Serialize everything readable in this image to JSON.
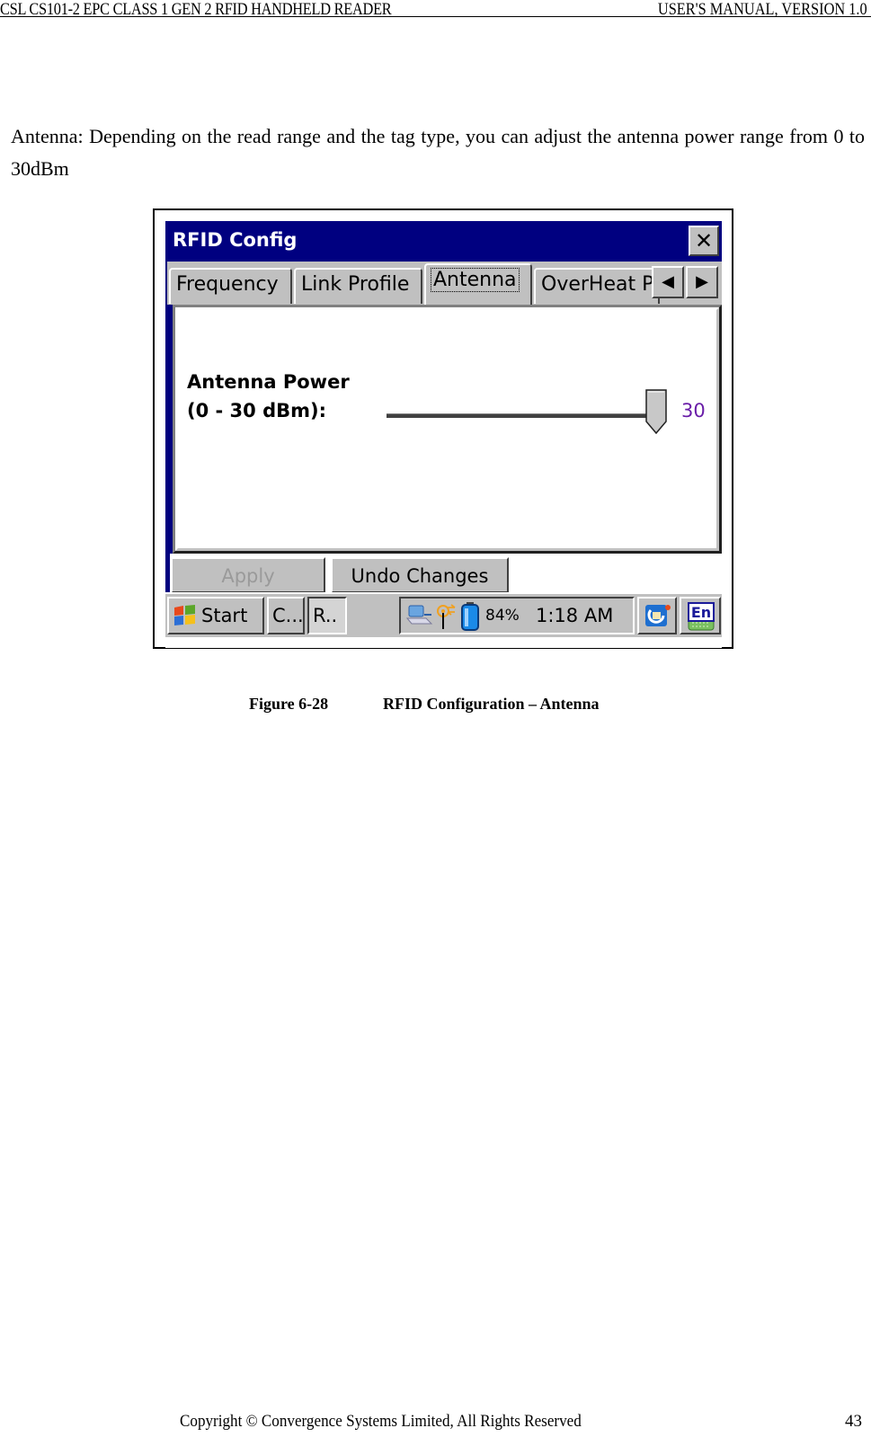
{
  "header": {
    "left": "CSL CS101-2 EPC CLASS 1 GEN 2 RFID HANDHELD READER",
    "right": "USER'S  MANUAL,  VERSION  1.0"
  },
  "body_text": "Antenna: Depending on the read range and the tag type, you can adjust the antenna power range from 0 to 30dBm",
  "screenshot": {
    "window_title": "RFID Config",
    "close_icon": "close-icon",
    "tabs": [
      {
        "label": "Frequency",
        "active": false
      },
      {
        "label": "Link Profile",
        "active": false
      },
      {
        "label": "Antenna",
        "active": true
      },
      {
        "label": "OverHeat P",
        "active": false
      }
    ],
    "tab_scroll_left": "◀",
    "tab_scroll_right": "▶",
    "antenna_power": {
      "label_line1": "Antenna Power",
      "label_line2": "(0 - 30 dBm):",
      "min": 0,
      "max": 30,
      "value": 30,
      "value_text": "30",
      "value_color": "#6a1ea8"
    },
    "buttons": {
      "apply": "Apply",
      "apply_enabled": false,
      "undo": "Undo Changes"
    },
    "taskbar": {
      "start": "Start",
      "task1": "C...",
      "task2": "R..",
      "battery": "84%",
      "time": "1:18 AM",
      "tray_icons": [
        "network-icon",
        "wireless-signal-icon",
        "battery-icon"
      ],
      "right_icons": [
        "activesync-icon",
        "input-language-en-icon"
      ],
      "input_lang": "En"
    }
  },
  "caption": {
    "figure": "Figure 6-28",
    "title": "RFID Configuration – Antenna"
  },
  "footer": {
    "copyright": "Copyright © Convergence Systems Limited, All Rights Reserved",
    "page": "43"
  }
}
